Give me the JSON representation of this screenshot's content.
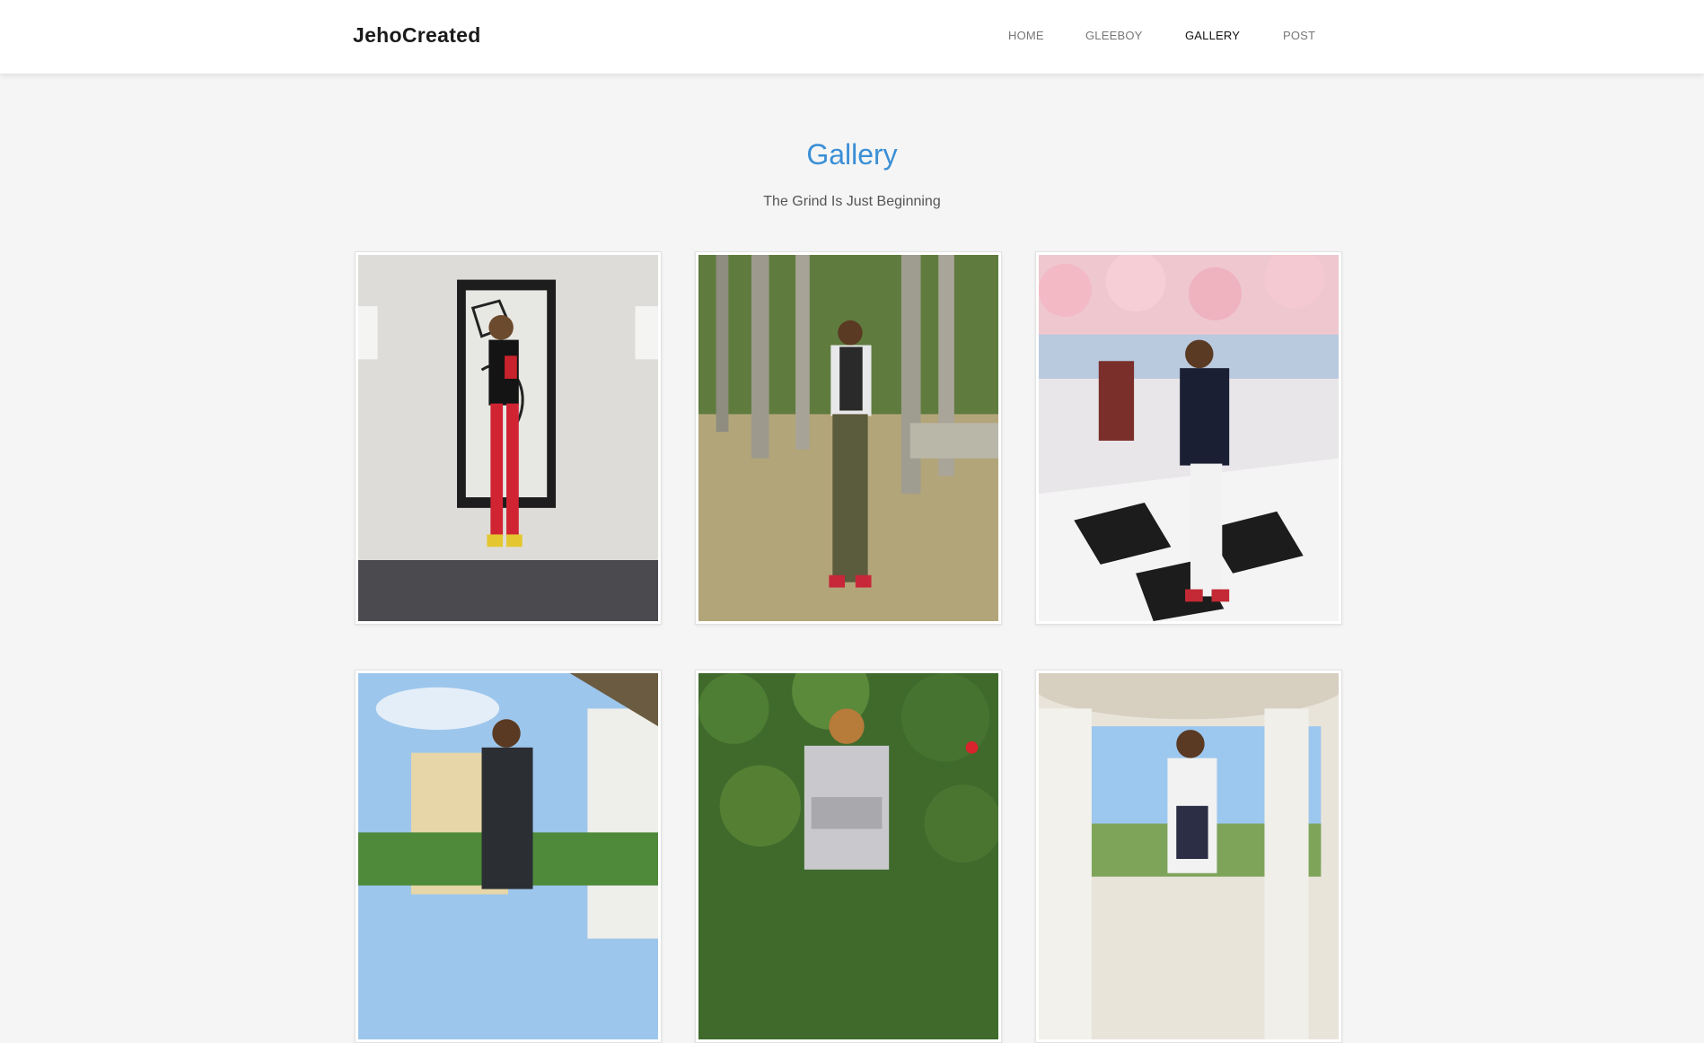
{
  "brand": "JehoCreated",
  "nav": {
    "items": [
      {
        "label": "HOME",
        "active": false
      },
      {
        "label": "GLEEBOY",
        "active": false
      },
      {
        "label": "GALLERY",
        "active": true
      },
      {
        "label": "POST",
        "active": false
      }
    ]
  },
  "gallery": {
    "title": "Gallery",
    "subtitle": "The Grind Is Just Beginning"
  },
  "colors": {
    "accent": "#3a8fd6",
    "page_background": "#f5f5f5"
  }
}
